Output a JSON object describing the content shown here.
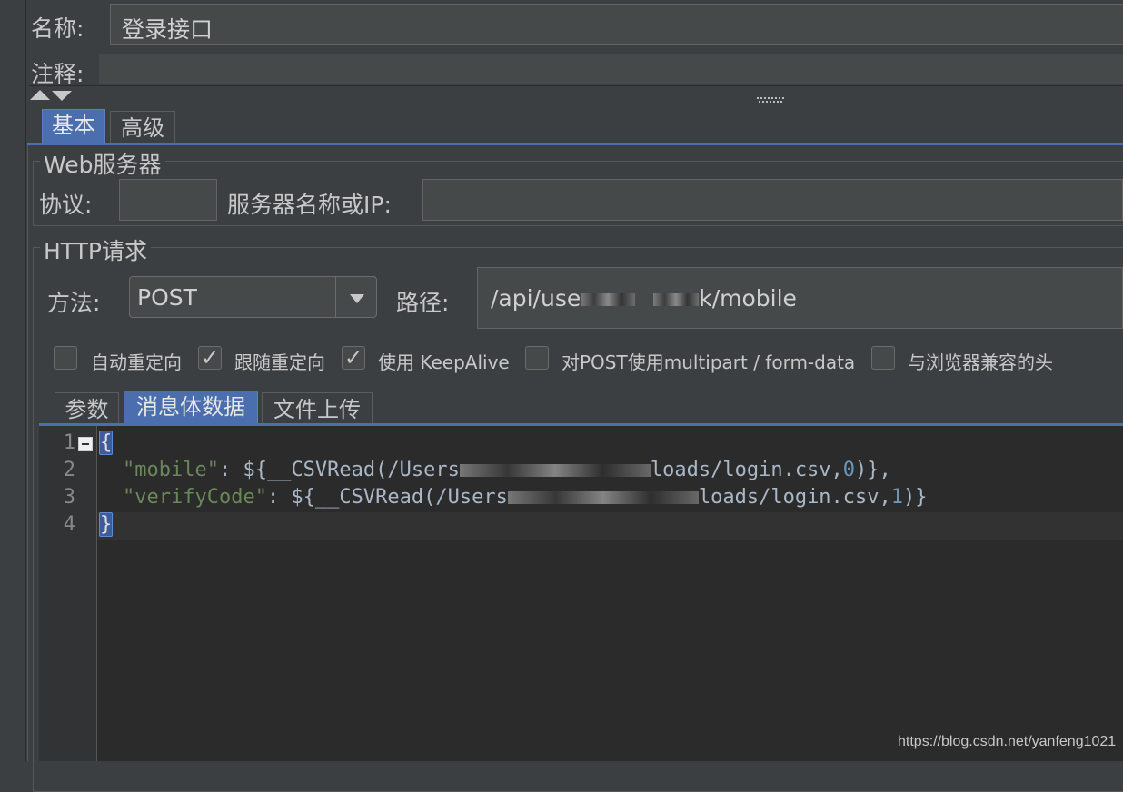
{
  "name_row": {
    "label": "名称:",
    "value": "登录接口"
  },
  "comment_row": {
    "label": "注释:",
    "value": ""
  },
  "top_tabs": [
    {
      "label": "基本",
      "active": true
    },
    {
      "label": "高级",
      "active": false
    }
  ],
  "web_server": {
    "title": "Web服务器",
    "protocol_label": "协议:",
    "protocol_value": "",
    "server_label": "服务器名称或IP:",
    "server_value": ""
  },
  "http_request": {
    "title": "HTTP请求",
    "method_label": "方法:",
    "method_value": "POST",
    "path_label": "路径:",
    "path_prefix": "/api/use",
    "path_suffix": "k/mobile"
  },
  "checkboxes": [
    {
      "label": "自动重定向",
      "checked": false
    },
    {
      "label": "跟随重定向",
      "checked": true
    },
    {
      "label": "使用 KeepAlive",
      "checked": true
    },
    {
      "label": "对POST使用multipart / form-data",
      "checked": false
    },
    {
      "label": "与浏览器兼容的头",
      "checked": false
    }
  ],
  "body_tabs": [
    {
      "label": "参数",
      "active": false
    },
    {
      "label": "消息体数据",
      "active": true
    },
    {
      "label": "文件上传",
      "active": false
    }
  ],
  "editor": {
    "line_numbers": [
      "1",
      "2",
      "3",
      "4"
    ],
    "line1": "{",
    "line2_key": "\"mobile\"",
    "line2_a": ": ${__CSVRead(/Users",
    "line2_b": "loads/login.csv,",
    "line2_num": "0",
    "line2_end": ")},",
    "line3_key": "\"verifyCode\"",
    "line3_a": ": ${__CSVRead(/Users",
    "line3_b": "loads/login.csv,",
    "line3_num": "1",
    "line3_end": ")}",
    "line4": "}"
  },
  "watermark": "https://blog.csdn.net/yanfeng1021",
  "colors": {
    "background": "#3c3f41",
    "active_tab": "#4b6eaf",
    "string": "#6a8759",
    "number": "#6897bb"
  }
}
